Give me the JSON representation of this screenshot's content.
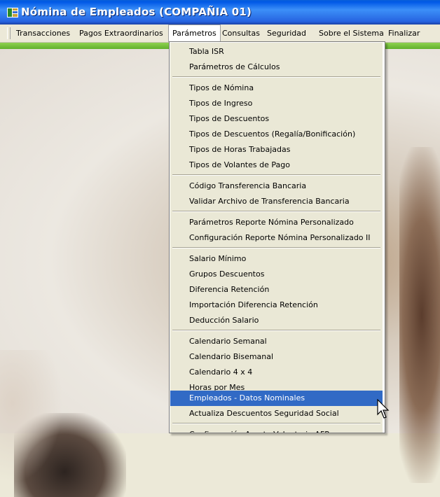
{
  "window": {
    "title": "Nómina de Empleados (COMPAÑIA 01)",
    "icon": "payroll-app-icon"
  },
  "menubar": {
    "items": [
      {
        "label": "Transacciones"
      },
      {
        "label": "Pagos Extraordinarios"
      },
      {
        "label": "Parámetros"
      },
      {
        "label": "Consultas"
      },
      {
        "label": "Seguridad"
      },
      {
        "label": "Sobre el Sistema"
      },
      {
        "label": "Finalizar"
      }
    ],
    "active": "Parámetros"
  },
  "dropdown": {
    "items": [
      {
        "label": "Tabla  ISR"
      },
      {
        "label": "Parámetros de Cálculos"
      },
      {
        "label": "Tipos de Nómina"
      },
      {
        "label": "Tipos de Ingreso"
      },
      {
        "label": "Tipos de Descuentos"
      },
      {
        "label": "Tipos de Descuentos (Regalía/Bonificación)"
      },
      {
        "label": "Tipos de Horas Trabajadas"
      },
      {
        "label": "Tipos de Volantes de Pago"
      },
      {
        "label": "Código Transferencia Bancaria"
      },
      {
        "label": "Validar Archivo de Transferencia Bancaria"
      },
      {
        "label": "Parámetros Reporte Nómina Personalizado"
      },
      {
        "label": "Configuración Reporte Nómina Personalizado II"
      },
      {
        "label": "Salario Mínimo"
      },
      {
        "label": "Grupos Descuentos"
      },
      {
        "label": "Diferencia Retención"
      },
      {
        "label": "Importación Diferencia Retención"
      },
      {
        "label": "Deducción Salario"
      },
      {
        "label": "Calendario Semanal"
      },
      {
        "label": "Calendario Bisemanal"
      },
      {
        "label": "Calendario 4 x 4"
      },
      {
        "label": "Horas por Mes"
      },
      {
        "label": "Empleados - Datos Nominales"
      },
      {
        "label": "Actualiza Descuentos Seguridad Social"
      },
      {
        "label": "Configuración Aporte Voluntario AFP"
      }
    ],
    "highlighted": "Empleados - Datos Nominales"
  },
  "colors": {
    "title_bar": "#0058e6",
    "menu_bg": "#ece9d8",
    "highlight": "#316ac5",
    "accent_green": "#6cbf3a"
  }
}
